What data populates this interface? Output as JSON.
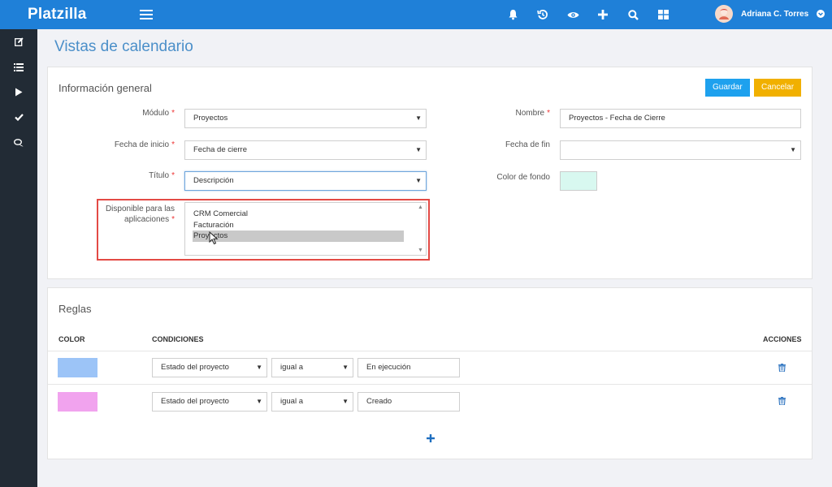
{
  "app": {
    "brand": "Platzilla",
    "user_name": "Adriana C. Torres"
  },
  "topbar_icons": [
    "bell-icon",
    "history-icon",
    "eye-icon",
    "plus-icon",
    "search-icon",
    "grid-icon"
  ],
  "sidebar": [
    "edit-icon",
    "list-icon",
    "play-icon",
    "check-icon",
    "chat-icon"
  ],
  "page": {
    "title": "Vistas de calendario"
  },
  "general": {
    "heading": "Información general",
    "save_label": "Guardar",
    "cancel_label": "Cancelar",
    "module_label": "Módulo",
    "module_value": "Proyectos",
    "start_label": "Fecha de inicio",
    "start_value": "Fecha de cierre",
    "title_label": "Título",
    "title_value": "Descripción",
    "apps_label_1": "Disponible para las",
    "apps_label_2": "aplicaciones",
    "apps_options": [
      "CRM Comercial",
      "Facturación",
      "Proyectos"
    ],
    "apps_selected": "Proyectos",
    "name_label": "Nombre",
    "name_value": "Proyectos - Fecha de Cierre",
    "end_label": "Fecha de fin",
    "end_value": "",
    "bg_color_label": "Color de fondo",
    "bg_color": "#d8f8f0",
    "required_mark": "*"
  },
  "rules": {
    "heading": "Reglas",
    "col_color": "COLOR",
    "col_conditions": "CONDICIONES",
    "col_actions": "ACCIONES",
    "rows": [
      {
        "color": "#9cc4f7",
        "field": "Estado del proyecto",
        "operator": "igual a",
        "value": "En ejecución"
      },
      {
        "color": "#f1a3ee",
        "field": "Estado del proyecto",
        "operator": "igual a",
        "value": "Creado"
      }
    ]
  },
  "colors": {
    "topbar": "#1f80d8",
    "sidebar": "#222b35",
    "save": "#1ea1ee",
    "cancel": "#f1b000",
    "highlight": "#e34a45"
  }
}
